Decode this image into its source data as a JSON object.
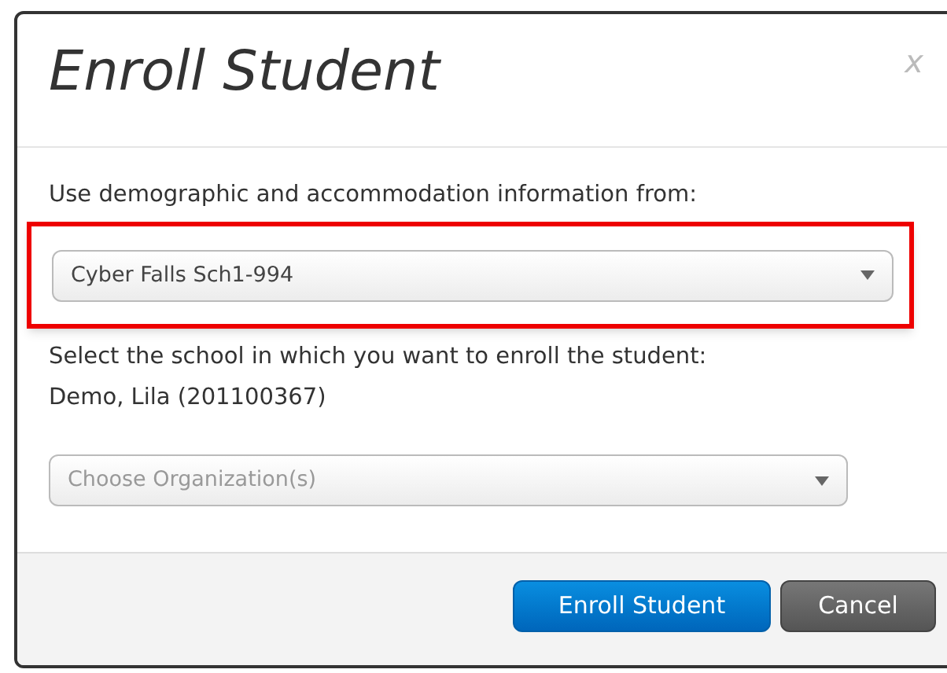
{
  "dialog": {
    "title": "Enroll Student",
    "close": "x",
    "source_label": "Use demographic and accommodation information from:",
    "source_select": {
      "value": "Cyber Falls Sch1-994",
      "highlighted": true
    },
    "school_label": "Select the school in which you want to enroll the student:",
    "student": "Demo, Lila (201100367)",
    "organization_select": {
      "placeholder": "Choose Organization(s)"
    },
    "buttons": [
      {
        "label": "Enroll Student",
        "kind": "primary"
      },
      {
        "label": "Cancel",
        "kind": "secondary"
      }
    ]
  }
}
